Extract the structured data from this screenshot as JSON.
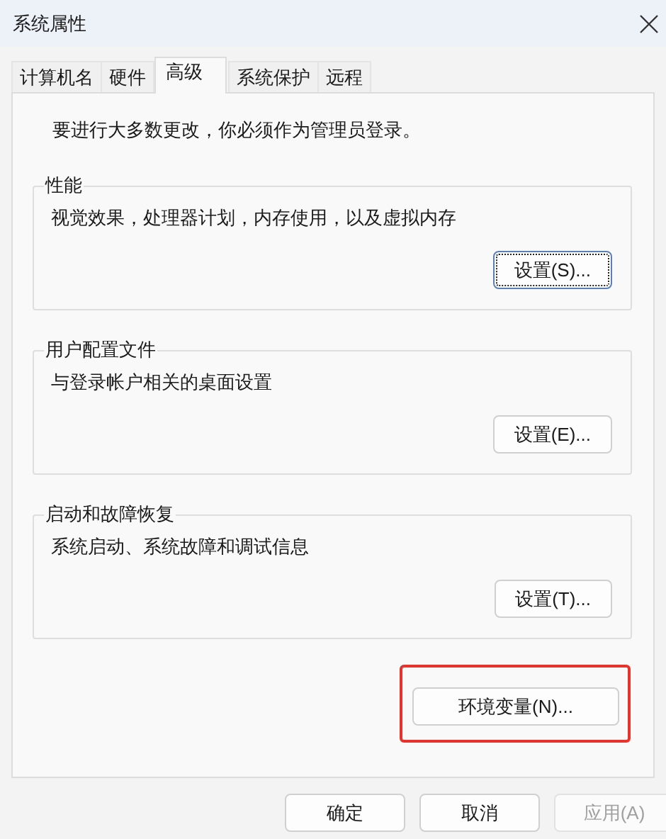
{
  "window": {
    "title": "系统属性"
  },
  "tabs": [
    {
      "label": "计算机名",
      "selected": false
    },
    {
      "label": "硬件",
      "selected": false
    },
    {
      "label": "高级",
      "selected": true
    },
    {
      "label": "系统保护",
      "selected": false
    },
    {
      "label": "远程",
      "selected": false
    }
  ],
  "notice": "要进行大多数更改，你必须作为管理员登录。",
  "groups": [
    {
      "title": "性能",
      "description": "视觉效果，处理器计划，内存使用，以及虚拟内存",
      "button": {
        "label": "设置(S)...",
        "focused": true
      }
    },
    {
      "title": "用户配置文件",
      "description": "与登录帐户相关的桌面设置",
      "button": {
        "label": "设置(E)...",
        "focused": false
      }
    },
    {
      "title": "启动和故障恢复",
      "description": "系统启动、系统故障和调试信息",
      "button": {
        "label": "设置(T)...",
        "focused": false
      }
    }
  ],
  "env_button": {
    "label": "环境变量(N)...",
    "highlighted": true
  },
  "footer_buttons": [
    {
      "label": "确定",
      "disabled": false
    },
    {
      "label": "取消",
      "disabled": false
    },
    {
      "label": "应用(A)",
      "disabled": true
    }
  ]
}
